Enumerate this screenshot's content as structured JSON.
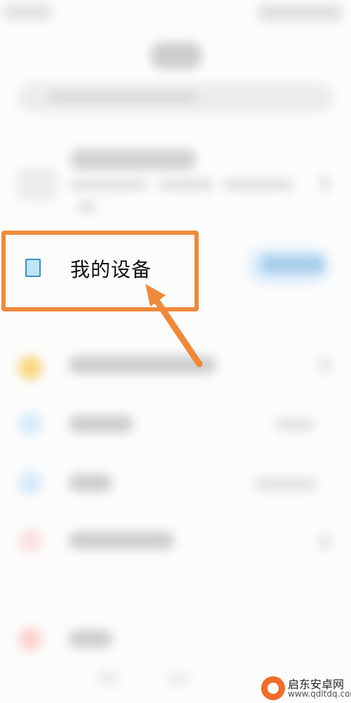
{
  "device_row": {
    "label": "我的设备",
    "icon": "phone-icon"
  },
  "annotation": {
    "box_color": "#f0893a",
    "arrow_color": "#f0893a"
  },
  "watermark": {
    "title": "启东安卓网",
    "url": "www.qdltdq.com"
  }
}
